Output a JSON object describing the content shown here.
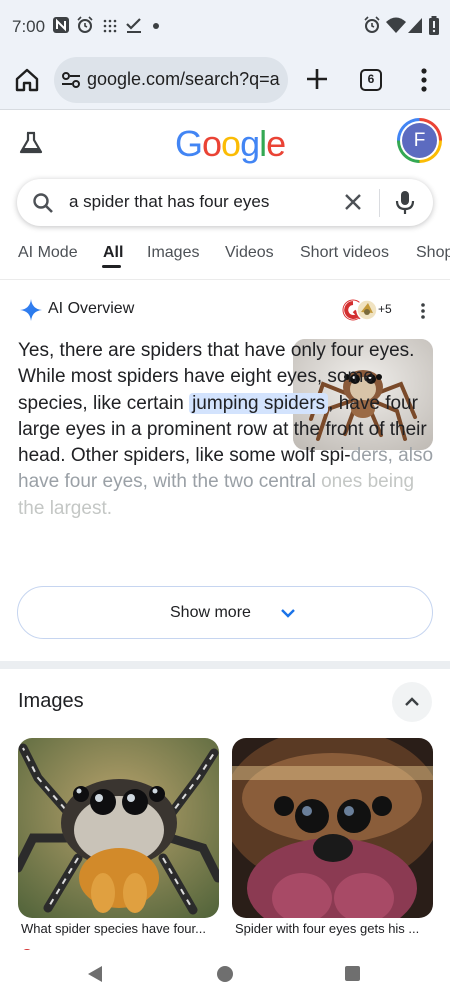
{
  "status_bar": {
    "time": "7:00",
    "left_icons": [
      "n-app-icon",
      "alarm-icon",
      "grid-dots-icon",
      "checkmark-icon",
      "dot-icon"
    ],
    "right_icons": [
      "alarm-icon",
      "wifi-icon",
      "signal-icon",
      "battery-icon"
    ]
  },
  "browser": {
    "url": "google.com/search?q=a",
    "tab_count": "6"
  },
  "header": {
    "logo_letters": [
      "G",
      "o",
      "o",
      "g",
      "l",
      "e"
    ],
    "avatar_initial": "F",
    "avatar_color": "#5c6bc0"
  },
  "search": {
    "query": "a spider that has four eyes"
  },
  "tabs": [
    {
      "label": "AI Mode",
      "active": false
    },
    {
      "label": "All",
      "active": true
    },
    {
      "label": "Images",
      "active": false
    },
    {
      "label": "Videos",
      "active": false
    },
    {
      "label": "Short videos",
      "active": false
    },
    {
      "label": "Shop",
      "active": false
    }
  ],
  "ai_overview": {
    "title": "AI Overview",
    "sources_extra": "+5",
    "text_before": "Yes, there are spiders that have only four eyes. While most spiders have eight eyes, some species, like certain ",
    "highlight": "jumping spiders",
    "text_after": ", have four large eyes in a prominent row at the front of their head. Other spiders, like some wolf spi-",
    "text_fade": "ders, also have four eyes, with the two central",
    "text_fade2": "ones being the largest.",
    "show_more": "Show more"
  },
  "images": {
    "title": "Images",
    "items": [
      {
        "caption": "What spider species have four..."
      },
      {
        "caption": "Spider with four eyes gets his ..."
      }
    ]
  },
  "colors": {
    "accent_blue": "#1a73e8",
    "highlight": "#d3e3fd"
  }
}
